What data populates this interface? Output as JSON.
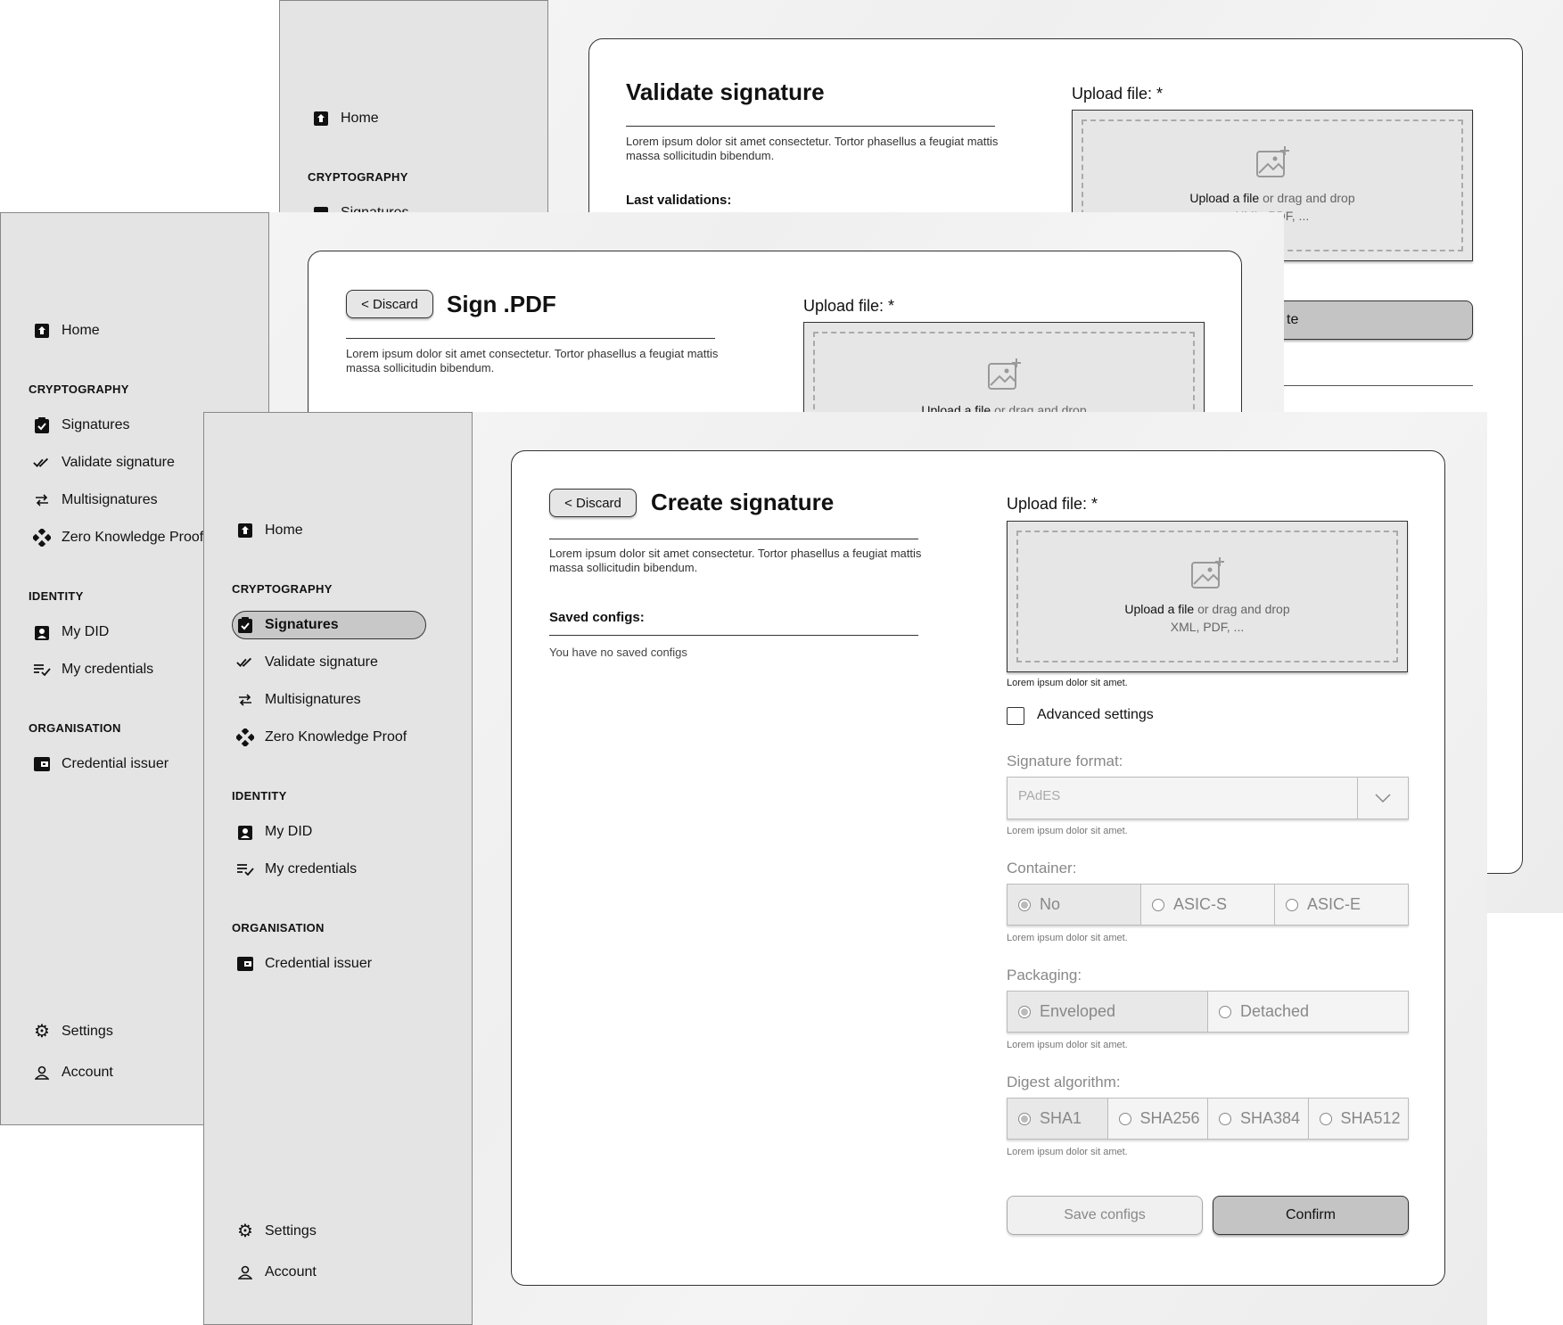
{
  "nav": {
    "home": "Home",
    "cryptography": "CRYPTOGRAPHY",
    "signatures": "Signatures",
    "validate": "Validate signature",
    "multisig": "Multisignatures",
    "zkp": "Zero Knowledge Proof",
    "identity": "IDENTITY",
    "my_did": "My DID",
    "my_credentials": "My credentials",
    "organisation": "ORGANISATION",
    "credential_issuer": "Credential issuer",
    "settings": "Settings",
    "account": "Account",
    "signatures_cut": "Signatures"
  },
  "common": {
    "discard": "< Discard",
    "upload_label": "Upload file: *",
    "upload_link": "Upload a file",
    "upload_rest": "or drag and drop",
    "upload_formats": "XML, PDF, ...",
    "upload_formats_cut": "XML, PDF, ...",
    "description": "Lorem ipsum dolor sit amet consectetur. Tortor phasellus a feugiat mattis massa sollicitudin bibendum.",
    "hint": "Lorem ipsum dolor sit amet."
  },
  "validate": {
    "title": "Validate signature",
    "last_validations": "Last validations:",
    "button_fragment": "te"
  },
  "sign_pdf": {
    "title": "Sign .PDF"
  },
  "create": {
    "title": "Create signature",
    "saved_configs": "Saved configs:",
    "no_configs": "You have no saved configs",
    "advanced": "Advanced settings",
    "signature_format_label": "Signature format:",
    "signature_format_value": "PAdES",
    "container_label": "Container:",
    "container_options": [
      "No",
      "ASIC-S",
      "ASIC-E"
    ],
    "packaging_label": "Packaging:",
    "packaging_options": [
      "Enveloped",
      "Detached"
    ],
    "digest_label": "Digest algorithm:",
    "digest_options": [
      "SHA1",
      "SHA256",
      "SHA384",
      "SHA512"
    ],
    "save_configs": "Save configs",
    "confirm": "Confirm"
  }
}
